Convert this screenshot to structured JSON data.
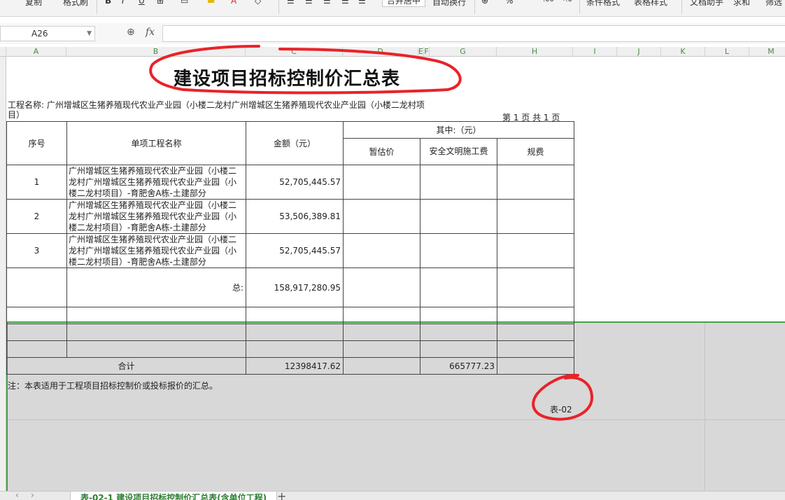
{
  "ribbon": {
    "copy": "复制",
    "format_painter": "格式刷",
    "merge_center": "合并居中",
    "auto_wrap": "自动换行",
    "cond_format": "条件格式",
    "table_style": "表格样式",
    "doc_helper": "文档助手",
    "sum": "求和",
    "filter": "筛选"
  },
  "formula_bar": {
    "cell_ref": "A26",
    "fx_label": "fx",
    "value": ""
  },
  "columns": [
    "A",
    "B",
    "C",
    "D",
    "E",
    "F",
    "G",
    "H",
    "I",
    "J",
    "K",
    "L",
    "M"
  ],
  "sheet": {
    "title": "建设项目招标控制价汇总表",
    "project_label": "工程名称: 广州增城区生猪养殖现代农业产业园（小楼二龙村广州增城区生猪养殖现代农业产业园（小楼二龙村项目）",
    "page_info": "第 1 页 共 1 页",
    "headers": {
      "seq": "序号",
      "name": "单项工程名称",
      "amount": "金额（元）",
      "including": "其中:（元）",
      "provisional": "暂估价",
      "safety": "安全文明施工费",
      "fees": "规费"
    },
    "rows": [
      {
        "seq": "1",
        "name": "广州增城区生猪养殖现代农业产业园（小楼二龙村广州增城区生猪养殖现代农业产业园（小楼二龙村项目）-育肥舍A栋-土建部分",
        "amount": "52,705,445.57"
      },
      {
        "seq": "2",
        "name": "广州增城区生猪养殖现代农业产业园（小楼二龙村广州增城区生猪养殖现代农业产业园（小楼二龙村项目）-育肥舍A栋-土建部分",
        "amount": "53,506,389.81"
      },
      {
        "seq": "3",
        "name": "广州增城区生猪养殖现代农业产业园（小楼二龙村广州增城区生猪养殖现代农业产业园（小楼二龙村项目）-育肥舍A栋-土建部分",
        "amount": "52,705,445.57"
      }
    ],
    "subtotal_label": "总:",
    "subtotal_amount": "158,917,280.95",
    "total_label": "合计",
    "total_amount": "12398417.62",
    "total_safety": "665777.23",
    "note": "注：本表适用于工程项目招标控制价或投标报价的汇总。",
    "table_code": "表-02"
  },
  "tabs": {
    "active": "表-02-1 建设项目招标控制价汇总表(含单位工程)"
  },
  "colors": {
    "accent_green": "#44a047",
    "annotation_red": "#e8232a"
  }
}
